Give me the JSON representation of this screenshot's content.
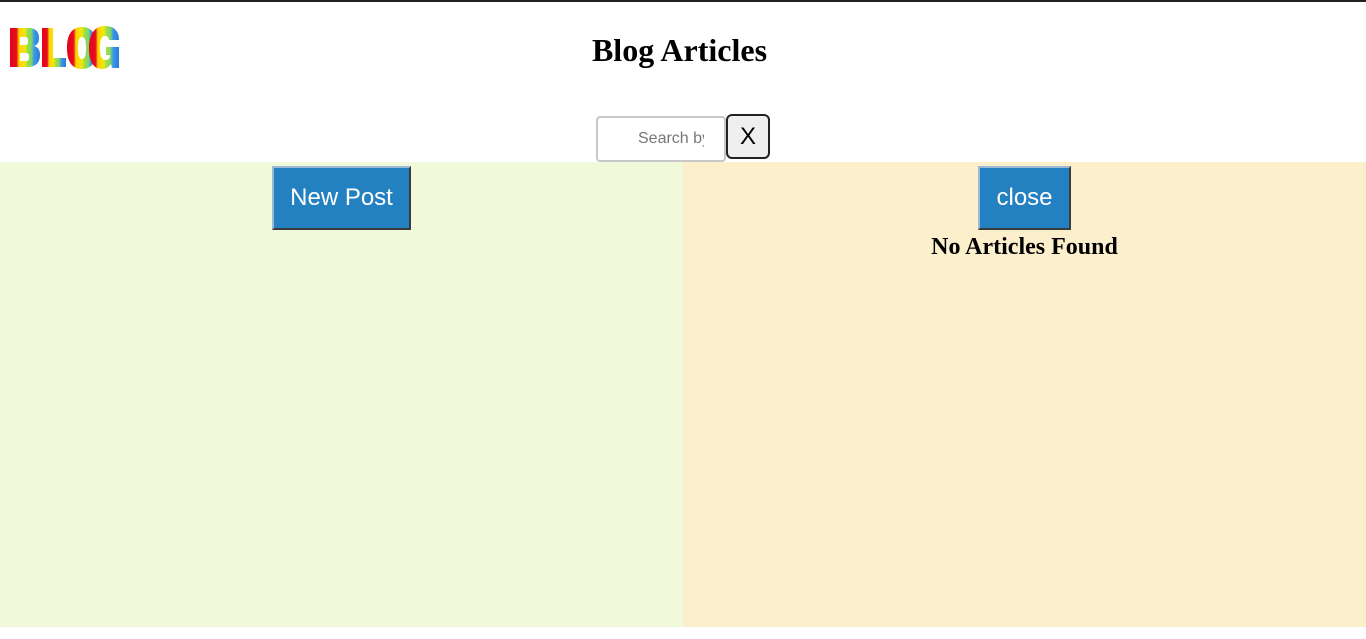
{
  "header": {
    "logo_text": "BLOG",
    "title": "Blog Articles"
  },
  "search": {
    "placeholder": "Search by",
    "value": "",
    "clear_label": "X"
  },
  "left_panel": {
    "new_post_label": "New Post",
    "background": "#f0fadb"
  },
  "right_panel": {
    "close_label": "close",
    "empty_message": "No Articles Found",
    "background": "#fcefcc"
  },
  "colors": {
    "button_blue": "#2481c1"
  }
}
